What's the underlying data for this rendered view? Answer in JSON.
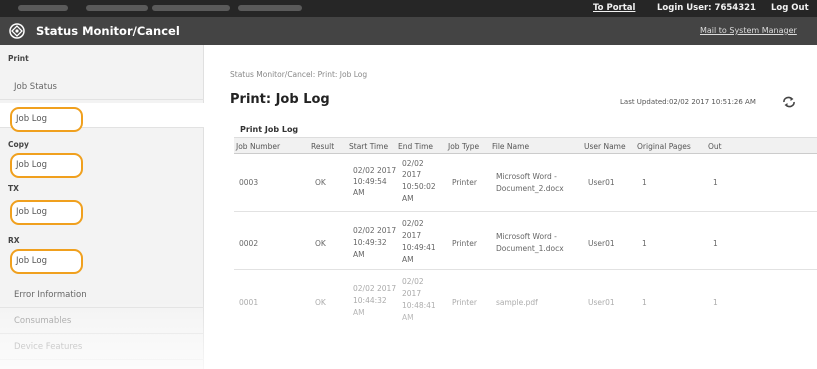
{
  "top_bar": {
    "portal_link": "To Portal",
    "login_user": "Login User:  7654321",
    "logout_link": "Log Out"
  },
  "header": {
    "title": "Status Monitor/Cancel",
    "mail_link": "Mail to System Manager"
  },
  "sidebar": {
    "sections": [
      {
        "heading": "Print",
        "items": [
          "Job Status",
          "Job Log"
        ]
      },
      {
        "heading": "Copy",
        "items": [
          "Job Log"
        ]
      },
      {
        "heading": "TX",
        "items": [
          "Job Log"
        ]
      },
      {
        "heading": "RX",
        "items": [
          "Job Log"
        ]
      }
    ],
    "extra_items": [
      "Error Information",
      "Consumables",
      "Device Features"
    ]
  },
  "main": {
    "breadcrumb": "Status Monitor/Cancel: Print: Job Log",
    "page_title": "Print: Job Log",
    "last_updated": "Last Updated:02/02 2017 10:51:26 AM",
    "section_title": "Print Job Log",
    "columns": [
      "Job Number",
      "Result",
      "Start Time",
      "End Time",
      "Job Type",
      "File Name",
      "User Name",
      "Original Pages",
      "Out"
    ],
    "rows": [
      {
        "job_number": "0003",
        "result": "OK",
        "start": [
          "02/02 2017",
          "10:49:54",
          "AM"
        ],
        "end": [
          "02/02",
          "2017",
          "10:50:02",
          "AM"
        ],
        "job_type": "Printer",
        "file_name": [
          "Microsoft Word -",
          "Document_2.docx"
        ],
        "user": "User01",
        "pages": "1",
        "out": "1"
      },
      {
        "job_number": "0002",
        "result": "OK",
        "start": [
          "02/02 2017",
          "10:49:32",
          "AM"
        ],
        "end": [
          "02/02",
          "2017",
          "10:49:41",
          "AM"
        ],
        "job_type": "Printer",
        "file_name": [
          "Microsoft Word -",
          "Document_1.docx"
        ],
        "user": "User01",
        "pages": "1",
        "out": "1"
      },
      {
        "job_number": "0001",
        "result": "OK",
        "start": [
          "02/02 2017",
          "10:44:32",
          "AM"
        ],
        "end": [
          "02/02",
          "2017",
          "10:48:41",
          "AM"
        ],
        "job_type": "Printer",
        "file_name": [
          "sample.pdf"
        ],
        "user": "User01",
        "pages": "1",
        "out": "1"
      }
    ]
  },
  "colors": {
    "top_bar": "#262626",
    "header_bar": "#444444",
    "sidebar_bg": "#f3f3f3",
    "highlight_ring": "#f0a01e"
  },
  "icons": {
    "logo": "canon-logo-icon",
    "refresh": "refresh-icon"
  }
}
